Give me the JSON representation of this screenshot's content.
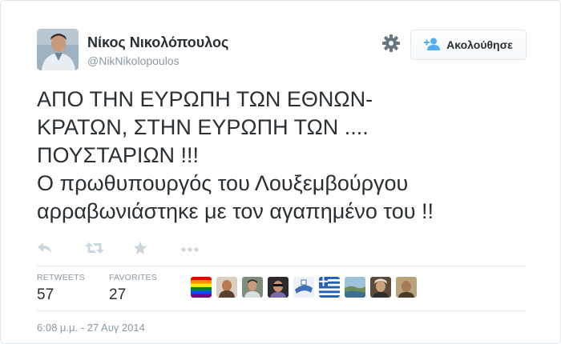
{
  "user": {
    "name": "Νίκος Νικολόπουλος",
    "handle": "@NikNikolopoulos"
  },
  "follow_button": {
    "label": "Ακολούθησε"
  },
  "tweet": {
    "text": "ΑΠΟ ΤΗΝ ΕΥΡΩΠΗ ΤΩΝ ΕΘΝΩΝ-\nΚΡΑΤΩΝ, ΣΤΗΝ ΕΥΡΩΠΗ ΤΩΝ ....\nΠΟΥΣΤΑΡΙΩΝ !!!\nΟ πρωθυπουργός του Λουξεμβούργου\nαρραβωνιάστηκε με τον αγαπημένο του !!"
  },
  "actions": [
    "reply-icon",
    "retweet-icon",
    "favorite-icon",
    "more-icon"
  ],
  "stats": {
    "retweets_label": "RETWEETS",
    "retweets_count": "57",
    "favorites_label": "FAVORITES",
    "favorites_count": "27"
  },
  "favorited_by_count_shown": 9,
  "timestamp": "6:08 μ.μ. - 27 Αυγ 2014",
  "colors": {
    "text": "#292f33",
    "muted": "#8899a6",
    "border": "#e1e8ed",
    "icon": "#ccd6dd"
  }
}
